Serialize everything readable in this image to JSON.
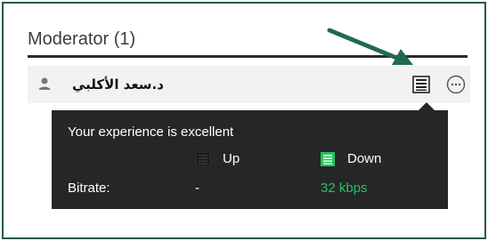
{
  "section": {
    "title": "Moderator (1)"
  },
  "user": {
    "name": "د.سعد الأكلبي",
    "avatar_icon": "user-avatar-icon",
    "stats_icon": "connection-stats-icon",
    "more_icon": "more-options-icon"
  },
  "annotation": {
    "arrow_icon": "callout-arrow-icon",
    "arrow_color": "#1f6b4f"
  },
  "tooltip": {
    "experience_text": "Your experience is excellent",
    "up_label": "Up",
    "down_label": "Down",
    "bitrate_label": "Bitrate:",
    "up_value": "-",
    "down_value": "32 kbps",
    "up_icon": "up-meter-icon",
    "down_icon": "down-meter-icon",
    "down_color": "#22c55e",
    "background": "#262626"
  },
  "colors": {
    "frame_border": "#1f5d47",
    "row_background": "#f2f2f2"
  }
}
